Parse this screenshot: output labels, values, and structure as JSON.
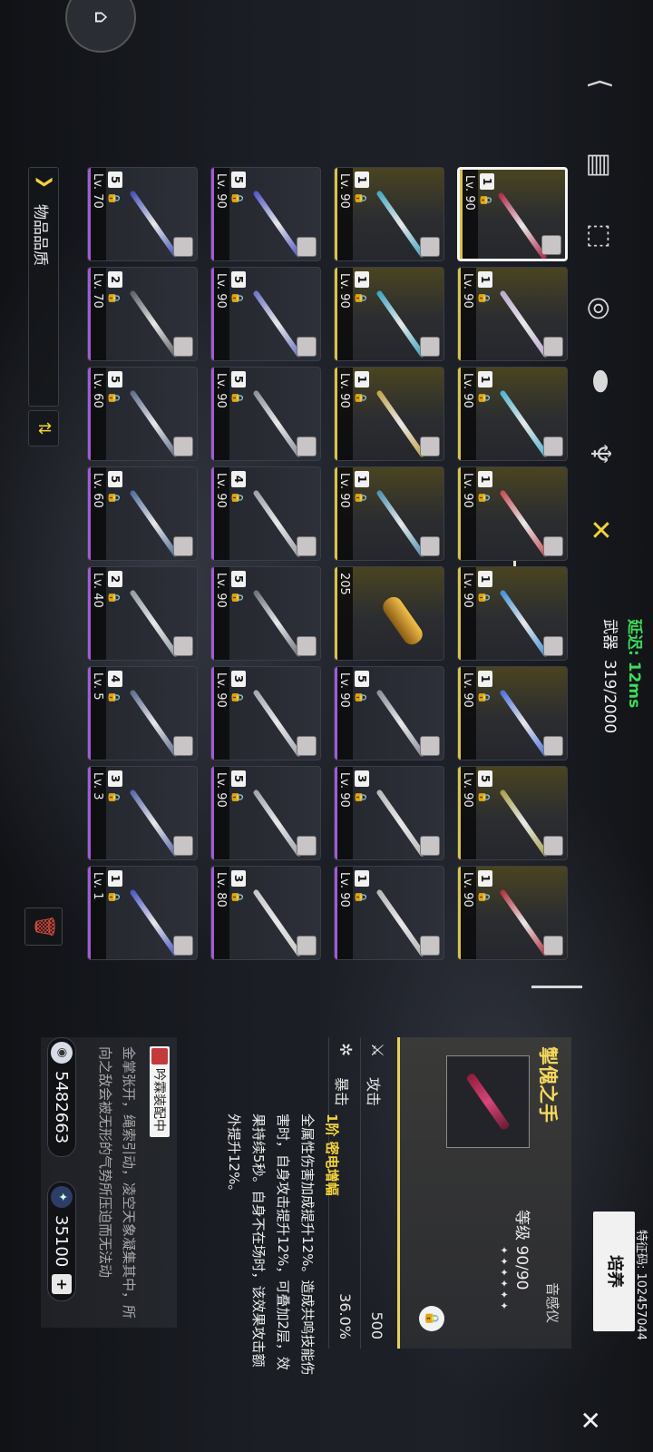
{
  "header": {
    "latency": "延迟: 12ms",
    "category_label": "武器",
    "count": "319/2000",
    "tabs": [
      "⟨",
      "▤",
      "⬚",
      "◎",
      "⬬",
      "♆",
      "✕"
    ]
  },
  "filter": {
    "label": "物品品质",
    "sort_icon": "⇅",
    "trash_icon": "🗑"
  },
  "grid": [
    [
      {
        "lv": "Lv. 90",
        "rank": "1",
        "q": "gold",
        "c": "#b0254b",
        "sel": true
      },
      {
        "lv": "Lv. 90",
        "rank": "1",
        "q": "gold",
        "c": "#b9a7d2"
      },
      {
        "lv": "Lv. 90",
        "rank": "1",
        "q": "gold",
        "c": "#4bb3d0"
      },
      {
        "lv": "Lv. 90",
        "rank": "1",
        "q": "gold",
        "c": "#c94a55"
      },
      {
        "lv": "Lv. 90",
        "rank": "1",
        "q": "gold",
        "c": "#3f8fd9"
      },
      {
        "lv": "Lv. 90",
        "rank": "1",
        "q": "gold",
        "c": "#4a6fe0"
      },
      {
        "lv": "Lv. 90",
        "rank": "5",
        "q": "gold",
        "c": "#a7a049"
      },
      {
        "lv": "Lv. 90",
        "rank": "1",
        "q": "gold",
        "c": "#b32b3a"
      }
    ],
    [
      {
        "lv": "Lv. 90",
        "rank": "1",
        "q": "gold",
        "c": "#3fa7c0"
      },
      {
        "lv": "Lv. 90",
        "rank": "1",
        "q": "gold",
        "c": "#37a3bf"
      },
      {
        "lv": "Lv. 90",
        "rank": "1",
        "q": "gold",
        "c": "#c1a24a"
      },
      {
        "lv": "Lv. 90",
        "rank": "1",
        "q": "gold",
        "c": "#4c8fb0"
      },
      {
        "lv": "205",
        "rank": "",
        "q": "gold",
        "c": "capsule"
      },
      {
        "lv": "Lv. 90",
        "rank": "5",
        "q": "purple",
        "c": "#8a8e9a"
      },
      {
        "lv": "Lv. 90",
        "rank": "3",
        "q": "purple",
        "c": "#b8b8b8"
      },
      {
        "lv": "Lv. 90",
        "rank": "1",
        "q": "purple",
        "c": "#b5b5b5"
      }
    ],
    [
      {
        "lv": "Lv. 90",
        "rank": "5",
        "q": "purple",
        "c": "#4d53c4"
      },
      {
        "lv": "Lv. 90",
        "rank": "5",
        "q": "purple",
        "c": "#6a73c0"
      },
      {
        "lv": "Lv. 90",
        "rank": "5",
        "q": "purple",
        "c": "#8b8f9a"
      },
      {
        "lv": "Lv. 90",
        "rank": "4",
        "q": "purple",
        "c": "#9a9ea8"
      },
      {
        "lv": "Lv. 90",
        "rank": "5",
        "q": "purple",
        "c": "#6b6f7a"
      },
      {
        "lv": "Lv. 90",
        "rank": "3",
        "q": "purple",
        "c": "#a2a6b0"
      },
      {
        "lv": "Lv. 90",
        "rank": "5",
        "q": "purple",
        "c": "#9fa3ad"
      },
      {
        "lv": "Lv. 80",
        "rank": "3",
        "q": "purple",
        "c": "#c7c7c7"
      }
    ],
    [
      {
        "lv": "Lv. 70",
        "rank": "5",
        "q": "purple",
        "c": "#3e4fb8"
      },
      {
        "lv": "Lv. 70",
        "rank": "2",
        "q": "purple",
        "c": "#5d5f66"
      },
      {
        "lv": "Lv. 60",
        "rank": "5",
        "q": "purple",
        "c": "#5c6a8e"
      },
      {
        "lv": "Lv. 60",
        "rank": "5",
        "q": "purple",
        "c": "#4d6b9a"
      },
      {
        "lv": "Lv. 40",
        "rank": "2",
        "q": "purple",
        "c": "#8f9aa0"
      },
      {
        "lv": "Lv. 5",
        "rank": "4",
        "q": "purple",
        "c": "#5a6b8f"
      },
      {
        "lv": "Lv. 3",
        "rank": "3",
        "q": "purple",
        "c": "#5366a8"
      },
      {
        "lv": "Lv. 1",
        "rank": "1",
        "q": "purple",
        "c": "#4553c2"
      }
    ]
  ],
  "detail": {
    "name": "掣傀之手",
    "type": "音感仪",
    "level_text": "等级 90/90",
    "stars": "✦✦✦✦✦✦",
    "stats": [
      {
        "icon": "⚔",
        "name": "攻击",
        "value": "500"
      },
      {
        "icon": "✲",
        "name": "暴击",
        "value": "36.0%"
      }
    ],
    "skill_title": "1阶 密电增幅",
    "skill_desc": "全属性伤害加成提升12%。造成共鸣技能伤害时，自身攻击提升12%，可叠加2层，效果持续5秒。自身不在场时，该效果攻击额外提升12%。",
    "equipped": "吟霖装配中",
    "flavor": "金掌张开，绳索引动，凌空天象凝集其中，所向之敌会被无形的气势所压迫而无法动"
  },
  "currency": {
    "shell": "5482663",
    "star": "35100"
  },
  "upgrade_label": "培养",
  "uid": "特征码: 102457044",
  "colors": {
    "accent": "#f3d23a",
    "gold_bar": "#d8c34a",
    "purple_bar": "#a15bd6",
    "latency": "#3ddc5a"
  }
}
